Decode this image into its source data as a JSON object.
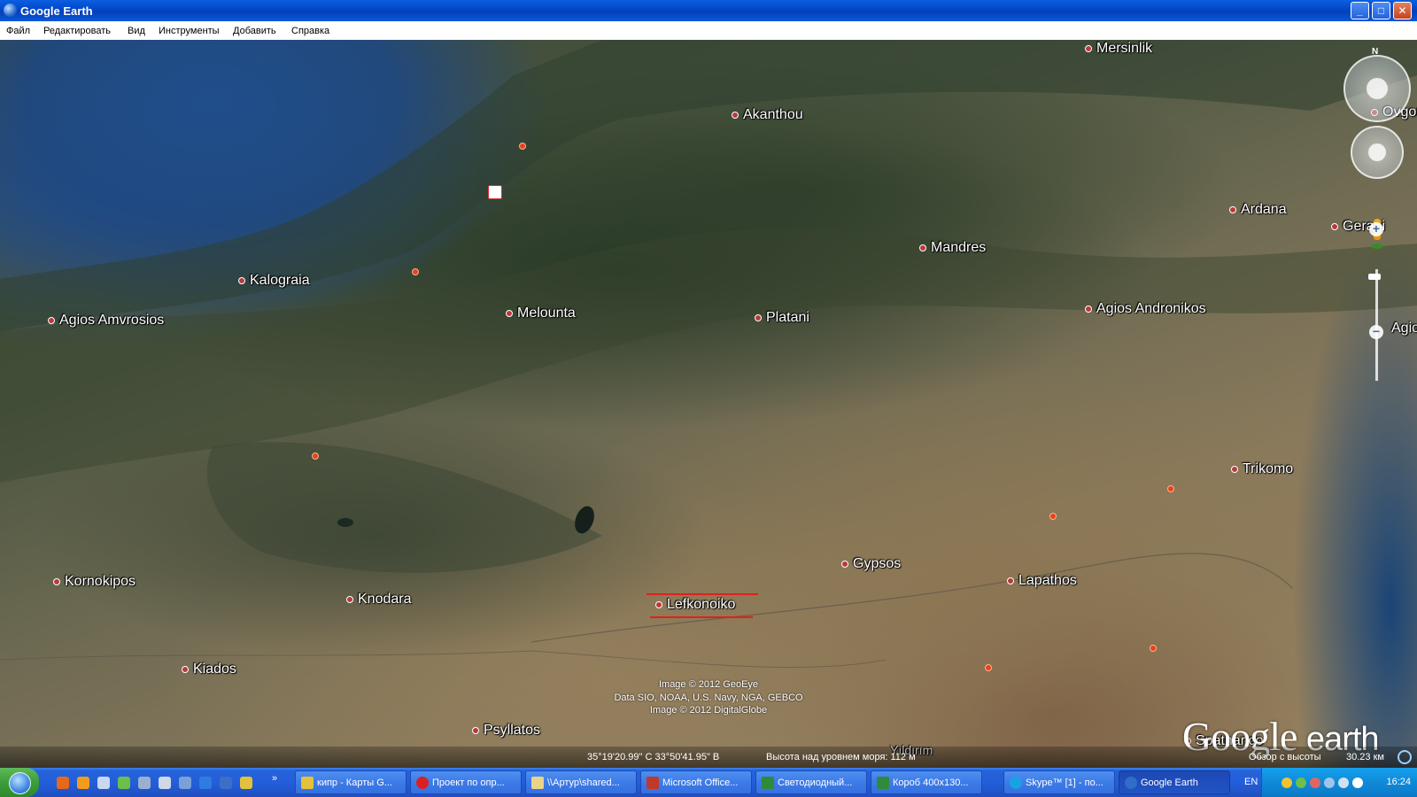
{
  "window": {
    "title": "Google Earth"
  },
  "menu": [
    "Файл",
    "Редактировать",
    "Вид",
    "Инструменты",
    "Добавить",
    "Справка"
  ],
  "places": [
    "Mersinlik",
    "Akanthou",
    "Ovgoros",
    "Ardana",
    "Gerani",
    "Kalograia",
    "Mandres",
    "Agios Amvrosios",
    "Melounta",
    "Platani",
    "Agios Andronikos",
    "Agios",
    "Trikomo",
    "Kornokipos",
    "Knodara",
    "Lefkonoiko",
    "Gypsos",
    "Lapathos",
    "Kiados",
    "Psyllatos",
    "Spatharico",
    "Yıldırım"
  ],
  "credits": {
    "line1": "Image © 2012 GeoEye",
    "line2": "Data SIO, NOAA, U.S. Navy, NGA, GEBCO",
    "line3": "Image © 2012 DigitalGlobe"
  },
  "logo": {
    "brand": "Google",
    "product": "earth"
  },
  "status": {
    "coords": "35°19'20.99\" С  33°50'41.95\" В",
    "elevation": "Высота над уровнем моря:  112 м",
    "eye_alt_label": "Обзор с высоты",
    "eye_alt_value": "30.23 км"
  },
  "compass": {
    "north": "N"
  },
  "taskbar": {
    "tasks": [
      "кипр - Карты G...",
      "Проект по опр...",
      "\\\\Артур\\shared...",
      "Microsoft Office...",
      "Светодиодный...",
      "Короб 400х130...",
      "Skype™ [1] - по...",
      "Google Earth"
    ],
    "lang": "EN",
    "clock": "16:24"
  },
  "colors": {
    "place_dot": "#b83a3a",
    "highlight_line": "#e0211b",
    "taskbar": "#245edb",
    "titlebar": "#0346c8"
  }
}
